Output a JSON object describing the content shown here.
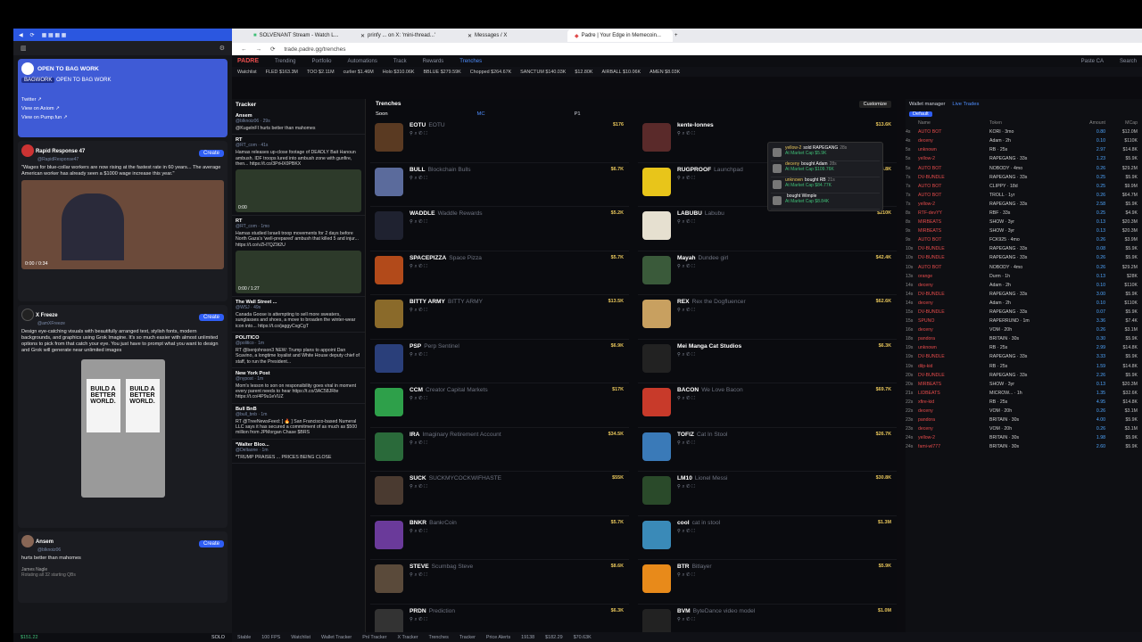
{
  "left": {
    "bag": {
      "title": "OPEN TO BAG WORK",
      "badge": "BAGWORK",
      "subtitle": "OPEN TO BAG WORK",
      "links": [
        "Twitter ↗",
        "View on Axiom ↗",
        "View on Pump.fun ↗"
      ]
    },
    "posts": [
      {
        "name": "Rapid Response 47",
        "handle": "@RapidResponse47",
        "btn": "Create",
        "text": "\"Wages for blue-collar workers are now rising at the fastest rate in 60 years... The average American worker has already seen a $1000 wage increase this year.\"",
        "time": "0:00 / 0:34"
      },
      {
        "name": "X Freeze",
        "handle": "@amXFreeze",
        "btn": "Create",
        "text": "Design eye-catching visuals with beautifully arranged text, stylish fonts, modern backgrounds, and graphics using Grok Imagine. It's so much easier with almost unlimited options to pick from that catch your eye. You just have to prompt what you want to design and Grok will generate near unlimited images",
        "poster": [
          "BUILD A BETTER WORLD.",
          "BUILD A BETTER WORLD."
        ]
      },
      {
        "name": "Ansem",
        "handle": "@blknoiz06",
        "btn": "Create",
        "text": "hurts better than mahomes",
        "reply": "James Nagle",
        "reply2": "Rotating all 32 starting QBs"
      }
    ],
    "footer": {
      "balance": "$151.22",
      "solo": "SOLO"
    }
  },
  "tabs": [
    "SOLVENANT Stream - Watch L...",
    "prinfy ... on X: 'mini-thread...'",
    "Messages / X",
    "Padre | Your Edge in Memecoin..."
  ],
  "url": "trade.padre.gg/trenches",
  "nav": {
    "logo": "PADRE",
    "items": [
      "Trending",
      "Portfolio",
      "Automations",
      "Track",
      "Rewards",
      "Trenches"
    ],
    "search": "Search",
    "paste": "Paste CA"
  },
  "ticker": [
    "Watchlist",
    "FLED $163.3M",
    "TOO $2.11M",
    "curlier $1.46M",
    "Holo $310.06K",
    "BBLUE $279.59K",
    "Chopped $264.67K",
    "SANCTUM $140.03K",
    "$12.80K",
    "AIRBALL $10.06K",
    "AMEN $8.03K"
  ],
  "tracker": {
    "title": "Tracker",
    "posts": [
      {
        "name": "Ansem",
        "handle": "@blknoiz06 · 29s",
        "text": "@KugelnFI hurts better than mahomes"
      },
      {
        "name": "RT",
        "handle": "@RT_com · 41s",
        "text": "Hamas releases up-close footage of DEADLY Bait Hanoun ambush. IDF troops lured into ambush zone with gunfire, then... https://t.co/3PrHX0PBKX",
        "time": "0:00"
      },
      {
        "name": "RT",
        "handle": "@RT_com · 1mo",
        "text": "Hamas studied Israeli troop movements for 2 days before North Gaza's 'well-prepared' ambush that killed 5 and injur... https://t.co/vZH7QZ9t2U",
        "time": "0:00 / 1:27"
      },
      {
        "name": "The Wall Street ...",
        "handle": "@WSJ · 49s",
        "text": "Canada Goose is attempting to sell more sweaters, sunglasses and shoes, a move to broaden the winter-wear icon into... https://t.co/jaggyCsgCgT"
      },
      {
        "name": "POLITICO",
        "handle": "@politico · 1m",
        "text": "RT @benjohnson3 NEW: Trump plans to appoint Dan Scavino, a longtime loyalist and White House deputy chief of staff, to run the President..."
      },
      {
        "name": "New York Post",
        "handle": "@nypost · 1m",
        "text": "Mom's lesson to son on responsibility goes viral in moment every parent needs to hear https://t.co/3AC58JRte https://t.co/4P9u1eVUZ"
      },
      {
        "name": "Bull BnB",
        "handle": "@bull_bnb · 1m",
        "text": "RT @TreeNewsFeed: [ 🔥 ] San Francisco-based Numeral LLC says it has secured a commitment of as much as $500 million from JPMorgan Chase $BRS"
      },
      {
        "name": "*Walter Bloo...",
        "handle": "@Deltaone · 1m",
        "text": "*TRUMP PRAISES ... PRICES BEING CLOSE"
      }
    ]
  },
  "trenches": {
    "title": "Trenches",
    "col1": "Soon",
    "mc": "MC",
    "p1": "P1",
    "customize": "Customize",
    "left": [
      {
        "t": "EOTU",
        "n": "EOTU",
        "mc": "$176",
        "c": "#5a3a22"
      },
      {
        "t": "BULL",
        "n": "Blockchain Bulls",
        "mc": "$6.7K",
        "c": "#5b6b9c"
      },
      {
        "t": "WADDLE",
        "n": "Waddle Rewards",
        "mc": "$5.2K",
        "c": "#1f2230"
      },
      {
        "t": "SPACEPIZZA",
        "n": "Space Pizza",
        "mc": "$5.7K",
        "c": "#b24a1a"
      },
      {
        "t": "BITTY ARMY",
        "n": "BITTY ARMY",
        "mc": "$13.5K",
        "c": "#8a6a2a"
      },
      {
        "t": "PSP",
        "n": "Perp Sentinel",
        "mc": "$6.9K",
        "c": "#2a3f7a"
      },
      {
        "t": "CCM",
        "n": "Creator Capital Markets",
        "mc": "$17K",
        "c": "#2ea04a"
      },
      {
        "t": "IRA",
        "n": "Imaginary Retirement Account",
        "mc": "$34.5K",
        "c": "#2a6a3a"
      },
      {
        "t": "SUCK",
        "n": "SUCKMYCOCKWIFHASTE",
        "mc": "$55K",
        "c": "#4a3a30"
      },
      {
        "t": "BNKR",
        "n": "BankrCoin",
        "mc": "$5.7K",
        "c": "#6a3a9a"
      },
      {
        "t": "STEVE",
        "n": "Scumbag Steve",
        "mc": "$8.6K",
        "c": "#5a4a3a"
      },
      {
        "t": "PRDN",
        "n": "Prediction",
        "mc": "$6.3K",
        "c": "#333"
      }
    ],
    "right": [
      {
        "t": "kente-lonnes",
        "n": "",
        "mc": "$13.6K",
        "c": "#5a2a2a"
      },
      {
        "t": "RUGPROOF",
        "n": "Launchpad",
        "mc": "$5.8K",
        "c": "#e8c51a"
      },
      {
        "t": "LABUBU",
        "n": "Labubu",
        "mc": "$210K",
        "c": "#e6e0d0"
      },
      {
        "t": "Mayah",
        "n": "Dundee girl",
        "mc": "$42.4K",
        "c": "#3a5a3a"
      },
      {
        "t": "REX",
        "n": "Rex the Dogfluencer",
        "mc": "$62.6K",
        "c": "#c8a060"
      },
      {
        "t": "Mei Manga Cat Studios",
        "n": "",
        "mc": "$6.3K",
        "c": "#222"
      },
      {
        "t": "BACON",
        "n": "We Love Bacon",
        "mc": "$69.7K",
        "c": "#c83a2a"
      },
      {
        "t": "TOFIZ",
        "n": "Cat In Stool",
        "mc": "$26.7K",
        "c": "#3a7ab8"
      },
      {
        "t": "LM10",
        "n": "Lionel Messi",
        "mc": "$30.8K",
        "c": "#2a4a2a"
      },
      {
        "t": "cool",
        "n": "cat in stool",
        "mc": "$1.3M",
        "c": "#3a8ab8"
      },
      {
        "t": "BTR",
        "n": "Bitlayer",
        "mc": "$5.9K",
        "c": "#e88a1a"
      },
      {
        "t": "BVM",
        "n": "ByteDance video model",
        "mc": "$1.0M",
        "c": "#222"
      }
    ]
  },
  "popup": [
    {
      "who": "yellow-2",
      "act": "sold RAPEGANG",
      "t": "28s",
      "mc": "At Market Cap $5.9K"
    },
    {
      "who": "deceny",
      "act": "bought Adam",
      "t": "28s",
      "mc": "At Market Cap $109.76K"
    },
    {
      "who": "unknown",
      "act": "bought RB",
      "t": "21s",
      "mc": "At Market Cap $84.77K"
    },
    {
      "who": "",
      "act": "bought Wimple",
      "t": "",
      "mc": "At Market Cap $8.84K"
    }
  ],
  "wallet": {
    "title": "Wallet manager",
    "live": "Live Trades",
    "preset": "Default",
    "headers": [
      "Name",
      "Token",
      "Amount",
      "MCap"
    ],
    "rows": [
      [
        "4s",
        "AUTO BOT",
        "KORI · 3mo",
        "0.80",
        "$12.0M"
      ],
      [
        "4s",
        "deceny",
        "Adam · 2h",
        "0.10",
        "$110K"
      ],
      [
        "5s",
        "unknown",
        "RB · 25s",
        "2.97",
        "$14.8K"
      ],
      [
        "5s",
        "yellow-2",
        "RAPEGANG · 33s",
        "1.23",
        "$5.9K"
      ],
      [
        "5s",
        "AUTO BOT",
        "NOBODY · 4mo",
        "0.26",
        "$29.2M"
      ],
      [
        "7s",
        "DV-BUNDLE",
        "RAPEGANG · 33s",
        "0.25",
        "$5.9K"
      ],
      [
        "7s",
        "AUTO BOT",
        "CLIPPY · 18d",
        "0.25",
        "$9.9M"
      ],
      [
        "7s",
        "AUTO BOT",
        "TROLL · 1yr",
        "0.26",
        "$64.7M"
      ],
      [
        "7s",
        "yellow-2",
        "RAPEGANG · 33s",
        "2.58",
        "$5.9K"
      ],
      [
        "8s",
        "RTF-devYY",
        "RBF · 33s",
        "0.25",
        "$4.9K"
      ],
      [
        "8s",
        "MIRBEATS",
        "SHOW · 3yr",
        "0.13",
        "$20.3M"
      ],
      [
        "9s",
        "MIRBEATS",
        "SHOW · 3yr",
        "0.13",
        "$20.3M"
      ],
      [
        "9s",
        "AUTO BOT",
        "FCK925 · 4mo",
        "0.26",
        "$3.9M"
      ],
      [
        "10s",
        "DV-BUNDLE",
        "RAPEGANG · 33s",
        "0.08",
        "$5.9K"
      ],
      [
        "10s",
        "DV-BUNDLE",
        "RAPEGANG · 33s",
        "0.26",
        "$5.9K"
      ],
      [
        "10s",
        "AUTO BOT",
        "NOBODY · 4mo",
        "0.26",
        "$29.2M"
      ],
      [
        "13s",
        "orange",
        "Durm · 1h",
        "0.13",
        "$28K"
      ],
      [
        "14s",
        "deceny",
        "Adam · 2h",
        "0.10",
        "$110K"
      ],
      [
        "14s",
        "DV-BUNDLE",
        "RAPEGANG · 33s",
        "3.00",
        "$5.9K"
      ],
      [
        "14s",
        "deceny",
        "Adam · 2h",
        "0.10",
        "$110K"
      ],
      [
        "15s",
        "DV-BUNDLE",
        "RAPEGANG · 33s",
        "0.07",
        "$5.9K"
      ],
      [
        "15s",
        "SPUNO",
        "RAPERRUND · 1m",
        "3.36",
        "$7.4K"
      ],
      [
        "16s",
        "deceny",
        "VOM · 20h",
        "0.26",
        "$3.1M"
      ],
      [
        "18s",
        "pandora",
        "BRITAIN · 30s",
        "0.30",
        "$5.9K"
      ],
      [
        "19s",
        "unknown",
        "RB · 25s",
        "2.99",
        "$14.8K"
      ],
      [
        "19s",
        "DV-BUNDLE",
        "RAPEGANG · 33s",
        "3.33",
        "$5.9K"
      ],
      [
        "19s",
        "dilp-kid",
        "RB · 25s",
        "1.59",
        "$14.8K"
      ],
      [
        "20s",
        "DV-BUNDLE",
        "RAPEGANG · 33s",
        "2.26",
        "$5.9K"
      ],
      [
        "20s",
        "MIRBEATS",
        "SHOW · 3yr",
        "0.13",
        "$20.3M"
      ],
      [
        "21s",
        "LIDBEATS",
        "MICROW... · 1h",
        "1.35",
        "$32.6K"
      ],
      [
        "22s",
        "xfire-kid",
        "RB · 25s",
        "4.95",
        "$14.8K"
      ],
      [
        "22s",
        "deceny",
        "VOM · 20h",
        "0.26",
        "$3.1M"
      ],
      [
        "23s",
        "pandora",
        "BRITAIN · 30s",
        "4.00",
        "$5.9K"
      ],
      [
        "23s",
        "deceny",
        "VOM · 20h",
        "0.26",
        "$3.1M"
      ],
      [
        "24s",
        "yellow-2",
        "BRITAIN · 30s",
        "1.98",
        "$5.9K"
      ],
      [
        "24s",
        "fami-wl777",
        "BRITAIN · 30s",
        "2.60",
        "$5.9K"
      ]
    ]
  },
  "footer": [
    "Stable",
    "100 FPS",
    "Watchlist",
    "Wallet Tracker",
    "Pnl Tracker",
    "X Tracker",
    "Trenches",
    "Tracker",
    "Price Alerts",
    "19138",
    "$182.29",
    "$70.63K"
  ],
  "colors": {
    "accent": "#2f5ef5",
    "positive": "#3fbf77",
    "negative": "#e04b4b",
    "brand": "#e84d4d"
  }
}
